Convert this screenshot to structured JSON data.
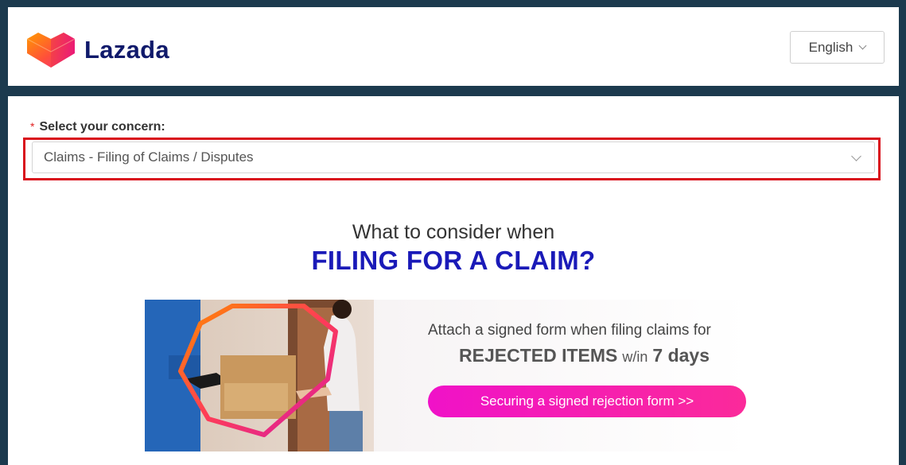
{
  "header": {
    "brand_name": "Lazada",
    "language_selected": "English"
  },
  "form": {
    "required_mark": "*",
    "concern_label": "Select your concern:",
    "concern_value": "Claims - Filing of Claims / Disputes"
  },
  "content": {
    "headline_line1": "What to consider when",
    "headline_line2": "FILING FOR A CLAIM?",
    "banner": {
      "line1": "Attach a signed form when filing claims for",
      "line2_bold": "REJECTED ITEMS",
      "line2_mid": "w/in",
      "line2_days": "7 days",
      "cta_label": "Securing a signed rejection form >>"
    }
  },
  "colors": {
    "background": "#1c3a4e",
    "brand_navy": "#101a6b",
    "headline_blue": "#1a1ab8",
    "highlight_red": "#d9101c",
    "cta_pink": "#f012c8"
  }
}
